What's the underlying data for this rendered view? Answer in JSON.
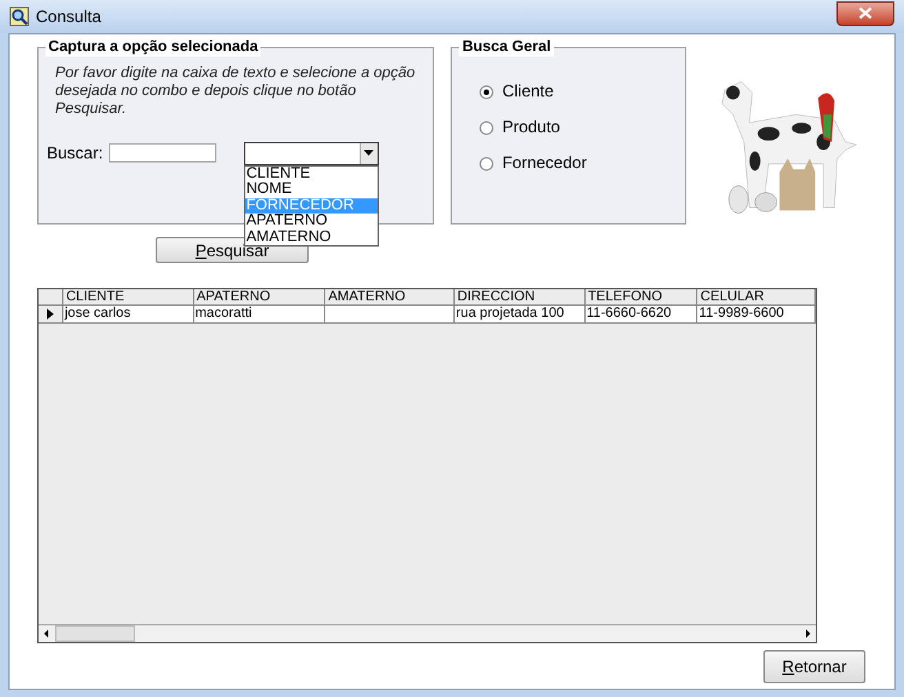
{
  "window": {
    "title": "Consulta"
  },
  "capture_group": {
    "title": "Captura a opção selecionada",
    "instructions": "Por favor digite na caixa de texto e selecione a opção desejada no combo e depois clique no botão Pesquisar.",
    "search_label": "Buscar:",
    "combo": {
      "expanded": true,
      "options": [
        {
          "label": "CLIENTE",
          "selected": false
        },
        {
          "label": "NOME",
          "selected": false
        },
        {
          "label": "FORNECEDOR",
          "selected": true
        },
        {
          "label": "APATERNO",
          "selected": false
        },
        {
          "label": "AMATERNO",
          "selected": false
        }
      ]
    },
    "search_button": "Pesquisar"
  },
  "general_search": {
    "title": "Busca Geral",
    "options": [
      {
        "label": "Cliente",
        "selected": true
      },
      {
        "label": "Produto",
        "selected": false
      },
      {
        "label": "Fornecedor",
        "selected": false
      }
    ]
  },
  "grid": {
    "columns": [
      "CLIENTE",
      "APATERNO",
      "AMATERNO",
      "DIRECCION",
      "TELEFONO",
      "CELULAR"
    ],
    "rows": [
      {
        "current": true,
        "cells": [
          "jose carlos",
          "macoratti",
          "",
          "rua projetada 100",
          "11-6660-6620",
          "11-9989-6600"
        ]
      }
    ]
  },
  "return_button": "Retornar"
}
